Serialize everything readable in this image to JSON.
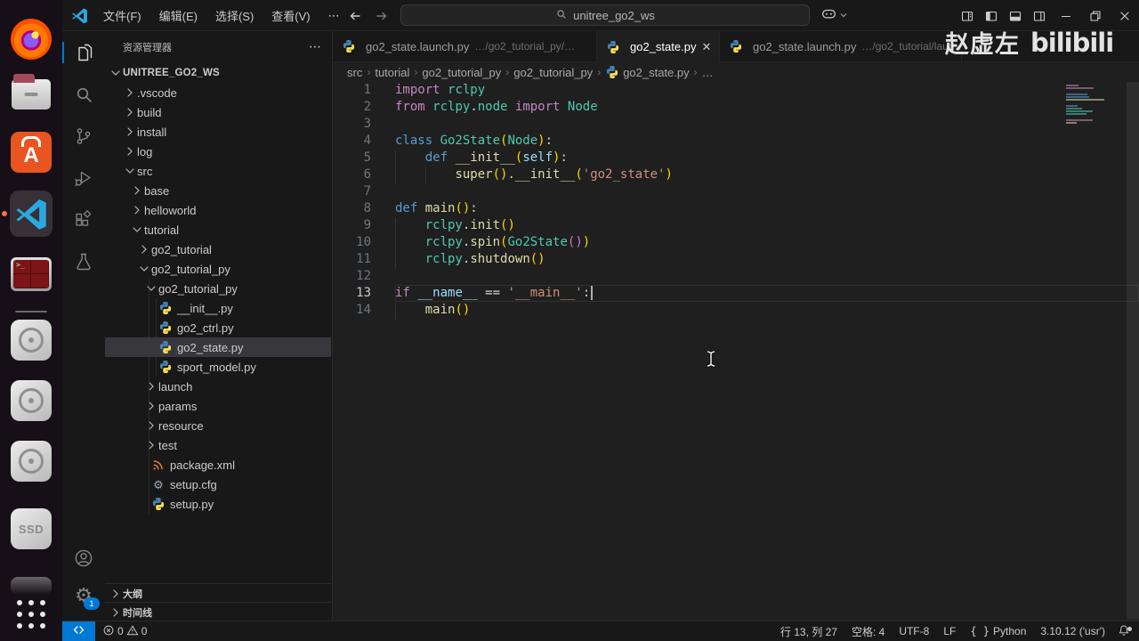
{
  "title_bar": {
    "menus": [
      "文件(F)",
      "编辑(E)",
      "选择(S)",
      "查看(V)"
    ],
    "menu_overflow": "⋯",
    "search_value": "unitree_go2_ws",
    "right_icons": [
      "customize-layout",
      "toggle-primary-sidebar",
      "toggle-panel",
      "toggle-secondary-sidebar"
    ],
    "window_buttons": [
      "minimize",
      "restore",
      "close"
    ]
  },
  "dock": {
    "items": [
      {
        "icon": "firefox"
      },
      {
        "icon": "file-manager"
      },
      {
        "icon": "ubuntu-software"
      },
      {
        "icon": "vscode",
        "active": true
      },
      {
        "icon": "terminal"
      },
      {
        "icon": "divider"
      },
      {
        "icon": "disk-utility"
      },
      {
        "icon": "disk-utility"
      },
      {
        "icon": "disk-utility"
      },
      {
        "icon": "ssd-drive",
        "label": "SSD"
      },
      {
        "icon": "drive-dim"
      },
      {
        "icon": "app-grid"
      }
    ]
  },
  "activity_bar": {
    "top": [
      {
        "icon": "explorer",
        "active": true
      },
      {
        "icon": "search"
      },
      {
        "icon": "source-control"
      },
      {
        "icon": "run-debug"
      },
      {
        "icon": "extensions"
      },
      {
        "icon": "testing"
      }
    ],
    "bottom": [
      {
        "icon": "accounts"
      },
      {
        "icon": "settings-gear",
        "badge": "1"
      }
    ]
  },
  "sidebar": {
    "title": "资源管理器",
    "actions_icon": "ellipsis",
    "tree": [
      {
        "label": "UNITREE_GO2_WS",
        "level": 0,
        "kind": "folder",
        "state": "open"
      },
      {
        "label": ".vscode",
        "level": 1,
        "kind": "folder",
        "state": "closed"
      },
      {
        "label": "build",
        "level": 1,
        "kind": "folder",
        "state": "closed"
      },
      {
        "label": "install",
        "level": 1,
        "kind": "folder",
        "state": "closed"
      },
      {
        "label": "log",
        "level": 1,
        "kind": "folder",
        "state": "closed"
      },
      {
        "label": "src",
        "level": 1,
        "kind": "folder",
        "state": "open"
      },
      {
        "label": "base",
        "level": 2,
        "kind": "folder",
        "state": "closed"
      },
      {
        "label": "helloworld",
        "level": 2,
        "kind": "folder",
        "state": "closed"
      },
      {
        "label": "tutorial",
        "level": 2,
        "kind": "folder",
        "state": "open"
      },
      {
        "label": "go2_tutorial",
        "level": 3,
        "kind": "folder",
        "state": "closed"
      },
      {
        "label": "go2_tutorial_py",
        "level": 3,
        "kind": "folder",
        "state": "open"
      },
      {
        "label": "go2_tutorial_py",
        "level": 4,
        "kind": "folder",
        "state": "open"
      },
      {
        "label": "__init__.py",
        "level": 5,
        "kind": "file",
        "icon": "python-file"
      },
      {
        "label": "go2_ctrl.py",
        "level": 5,
        "kind": "file",
        "icon": "python-file"
      },
      {
        "label": "go2_state.py",
        "level": 5,
        "kind": "file",
        "icon": "python-file",
        "selected": true
      },
      {
        "label": "sport_model.py",
        "level": 5,
        "kind": "file",
        "icon": "python-file"
      },
      {
        "label": "launch",
        "level": 4,
        "kind": "folder",
        "state": "closed"
      },
      {
        "label": "params",
        "level": 4,
        "kind": "folder",
        "state": "closed"
      },
      {
        "label": "resource",
        "level": 4,
        "kind": "folder",
        "state": "closed"
      },
      {
        "label": "test",
        "level": 4,
        "kind": "folder",
        "state": "closed"
      },
      {
        "label": "package.xml",
        "level": 4,
        "kind": "file",
        "icon": "xml-file"
      },
      {
        "label": "setup.cfg",
        "level": 4,
        "kind": "file",
        "icon": "gear-file"
      },
      {
        "label": "setup.py",
        "level": 4,
        "kind": "file",
        "icon": "python-file"
      }
    ],
    "panels": [
      {
        "label": "大纲"
      },
      {
        "label": "时间线"
      }
    ]
  },
  "tabs": [
    {
      "label": "go2_state.launch.py",
      "desc": "…/go2_tutorial_py/…",
      "icon": "python-file",
      "active": false
    },
    {
      "label": "go2_state.py",
      "desc": "",
      "icon": "python-file",
      "active": true,
      "close": "✕"
    },
    {
      "label": "go2_state.launch.py",
      "desc": "…/go2_tutorial/laun…",
      "icon": "python-file",
      "active": false
    }
  ],
  "breadcrumb": [
    "src",
    "tutorial",
    "go2_tutorial_py",
    "go2_tutorial_py",
    "go2_state.py",
    "…"
  ],
  "editor": {
    "current_line": 13,
    "cursor": "行 13, 列 27",
    "lines": [
      {
        "n": 1,
        "tokens": [
          [
            "import ",
            "k"
          ],
          [
            "rclpy",
            "t"
          ]
        ]
      },
      {
        "n": 2,
        "tokens": [
          [
            "from ",
            "k"
          ],
          [
            "rclpy",
            "t"
          ],
          [
            ".",
            "d"
          ],
          [
            "node",
            "t"
          ],
          [
            " import ",
            "k"
          ],
          [
            "Node",
            "t"
          ]
        ]
      },
      {
        "n": 3,
        "tokens": []
      },
      {
        "n": 4,
        "tokens": [
          [
            "class ",
            "c"
          ],
          [
            "Go2State",
            "t"
          ],
          [
            "(",
            "b1"
          ],
          [
            "Node",
            "t"
          ],
          [
            ")",
            "b1"
          ],
          [
            ":",
            "d"
          ]
        ]
      },
      {
        "n": 5,
        "tokens": [
          [
            "    ",
            "ind"
          ],
          [
            "def ",
            "c"
          ],
          [
            "__init__",
            "f"
          ],
          [
            "(",
            "b1"
          ],
          [
            "self",
            "v"
          ],
          [
            ")",
            "b1"
          ],
          [
            ":",
            "d"
          ]
        ]
      },
      {
        "n": 6,
        "tokens": [
          [
            "    ",
            "ind"
          ],
          [
            "    ",
            "ind"
          ],
          [
            "super",
            "f"
          ],
          [
            "()",
            "b1"
          ],
          [
            ".",
            "d"
          ],
          [
            "__init__",
            "f"
          ],
          [
            "(",
            "b1"
          ],
          [
            "'go2_state'",
            "s"
          ],
          [
            ")",
            "b1"
          ]
        ]
      },
      {
        "n": 7,
        "tokens": []
      },
      {
        "n": 8,
        "tokens": [
          [
            "def ",
            "c"
          ],
          [
            "main",
            "f"
          ],
          [
            "()",
            "b1"
          ],
          [
            ":",
            "d"
          ]
        ]
      },
      {
        "n": 9,
        "tokens": [
          [
            "    ",
            "ind"
          ],
          [
            "rclpy",
            "t"
          ],
          [
            ".",
            "d"
          ],
          [
            "init",
            "f"
          ],
          [
            "()",
            "b1"
          ]
        ]
      },
      {
        "n": 10,
        "tokens": [
          [
            "    ",
            "ind"
          ],
          [
            "rclpy",
            "t"
          ],
          [
            ".",
            "d"
          ],
          [
            "spin",
            "f"
          ],
          [
            "(",
            "b1"
          ],
          [
            "Go2State",
            "t"
          ],
          [
            "()",
            "b2"
          ],
          [
            ")",
            "b1"
          ]
        ]
      },
      {
        "n": 11,
        "tokens": [
          [
            "    ",
            "ind"
          ],
          [
            "rclpy",
            "t"
          ],
          [
            ".",
            "d"
          ],
          [
            "shutdown",
            "f"
          ],
          [
            "()",
            "b1"
          ]
        ]
      },
      {
        "n": 12,
        "tokens": []
      },
      {
        "n": 13,
        "tokens": [
          [
            "if ",
            "k"
          ],
          [
            "__name__",
            "v"
          ],
          [
            " == ",
            "d"
          ],
          [
            "'__main__'",
            "s"
          ],
          [
            ":",
            "d"
          ]
        ]
      },
      {
        "n": 14,
        "tokens": [
          [
            "    ",
            "ind"
          ],
          [
            "main",
            "f"
          ],
          [
            "()",
            "b1"
          ]
        ]
      }
    ]
  },
  "status_bar": {
    "errors": "0",
    "warnings": "0",
    "right": [
      {
        "label": "行 13, 列 27"
      },
      {
        "label": "空格: 4"
      },
      {
        "label": "UTF-8"
      },
      {
        "label": "LF"
      },
      {
        "icon": "braces",
        "label": "Python"
      },
      {
        "label": "3.10.12 ('usr')"
      }
    ],
    "bell_icon": "bell"
  },
  "watermark": {
    "author": "赵虚左",
    "brand": "bilibili"
  }
}
